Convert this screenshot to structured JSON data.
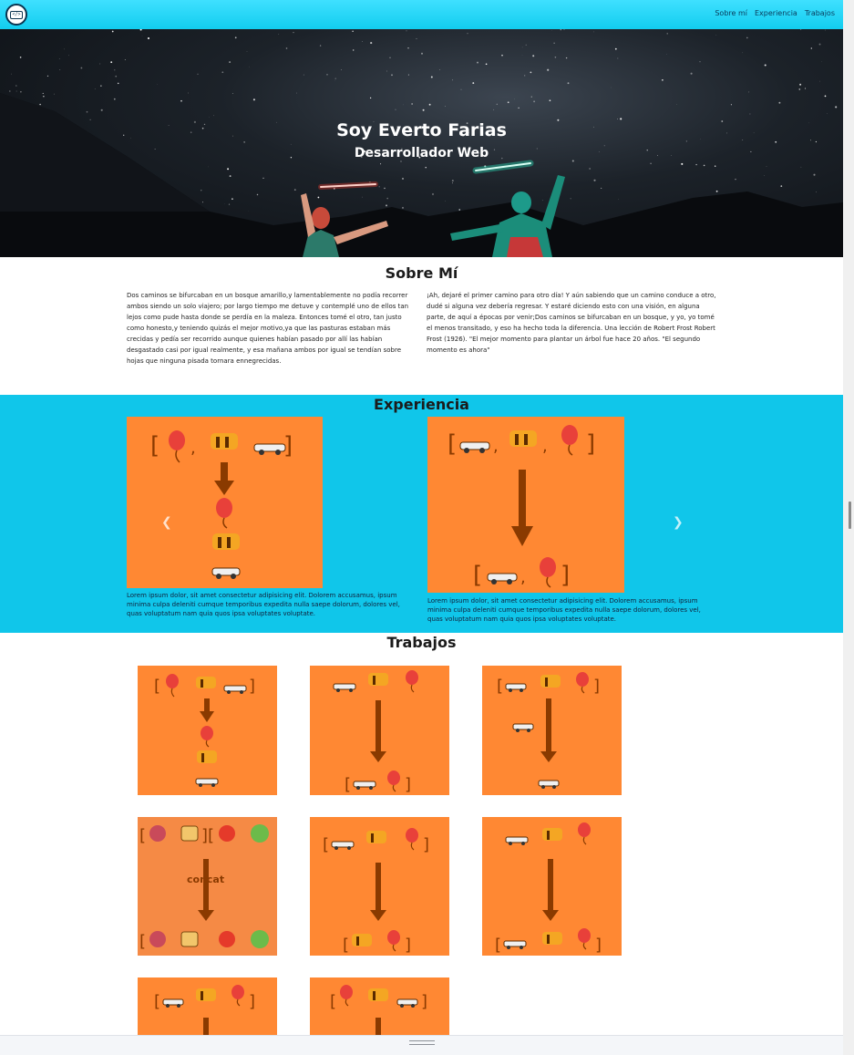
{
  "navbar": {
    "links": [
      "Sobre mí",
      "Experiencia",
      "Trabajos"
    ]
  },
  "hero": {
    "title": "Soy Everto Farias",
    "subtitle": "Desarrollador Web"
  },
  "about": {
    "title": "Sobre Mí",
    "col1": "Dos caminos se bifurcaban en un bosque amarillo,y lamentablemente no podía recorrer ambos siendo un solo viajero; por largo tiempo me detuve y contemplé uno de ellos tan lejos como pude hasta donde se perdía en la maleza. Entonces tomé el otro, tan justo como honesto,y teniendo quizás el mejor motivo,ya que las pasturas estaban más crecidas y pedía ser recorrido aunque quienes habían pasado por allí las habían desgastado casi por igual realmente, y esa mañana ambos por igual se tendían sobre hojas que ninguna pisada tornara ennegrecidas.",
    "col2": "¡Ah, dejaré el primer camino para otro día! Y aún sabiendo que un camino conduce a otro, dudé si alguna vez debería regresar. Y estaré diciendo esto con una visión, en alguna parte, de aquí a épocas por venir;Dos caminos se bifurcaban en un bosque, y yo, yo tomé el menos transitado, y eso ha hecho toda la diferencia. Una lección de Robert Frost Robert Frost (1926). \"El mejor momento para plantar un árbol fue hace 20 años. \"El segundo momento es ahora\""
  },
  "experience": {
    "title": "Experiencia",
    "cards": [
      {
        "text": "Lorem ipsum dolor, sit amet consectetur adipisicing elit. Dolorem accusamus, ipsum minima culpa deleniti cumque temporibus expedita nulla saepe dolorum, dolores vel, quas voluptatum nam quia quos ipsa voluptates voluptate."
      },
      {
        "text": "Lorem ipsum dolor, sit amet consectetur adipisicing elit. Dolorem accusamus, ipsum minima culpa deleniti cumque temporibus expedita nulla saepe dolorum, dolores vel, quas voluptatum nam quia quos ipsa voluptates voluptate."
      }
    ],
    "prev_icon": "chevron-left-icon",
    "next_icon": "chevron-right-icon"
  },
  "jobs": {
    "title": "Trabajos",
    "concat_label": "concat"
  },
  "colors": {
    "accent": "#10c6ea",
    "card": "#ff8833",
    "arrow": "#8a3a00"
  }
}
